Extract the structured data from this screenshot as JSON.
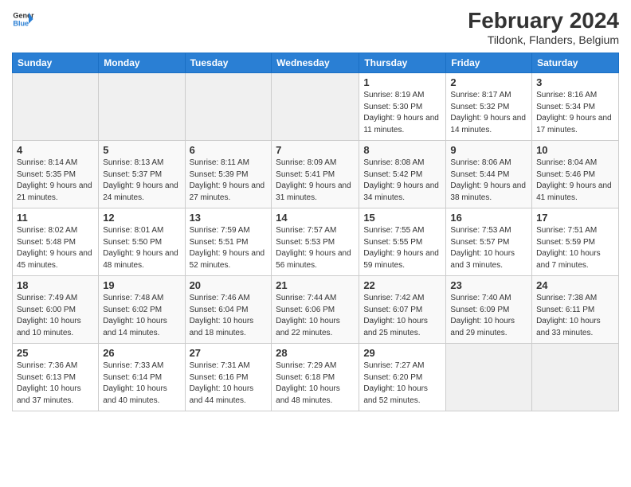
{
  "header": {
    "logo_line1": "General",
    "logo_line2": "Blue",
    "month_year": "February 2024",
    "location": "Tildonk, Flanders, Belgium"
  },
  "days_of_week": [
    "Sunday",
    "Monday",
    "Tuesday",
    "Wednesday",
    "Thursday",
    "Friday",
    "Saturday"
  ],
  "weeks": [
    [
      {
        "day": "",
        "info": ""
      },
      {
        "day": "",
        "info": ""
      },
      {
        "day": "",
        "info": ""
      },
      {
        "day": "",
        "info": ""
      },
      {
        "day": "1",
        "info": "Sunrise: 8:19 AM\nSunset: 5:30 PM\nDaylight: 9 hours and 11 minutes."
      },
      {
        "day": "2",
        "info": "Sunrise: 8:17 AM\nSunset: 5:32 PM\nDaylight: 9 hours and 14 minutes."
      },
      {
        "day": "3",
        "info": "Sunrise: 8:16 AM\nSunset: 5:34 PM\nDaylight: 9 hours and 17 minutes."
      }
    ],
    [
      {
        "day": "4",
        "info": "Sunrise: 8:14 AM\nSunset: 5:35 PM\nDaylight: 9 hours and 21 minutes."
      },
      {
        "day": "5",
        "info": "Sunrise: 8:13 AM\nSunset: 5:37 PM\nDaylight: 9 hours and 24 minutes."
      },
      {
        "day": "6",
        "info": "Sunrise: 8:11 AM\nSunset: 5:39 PM\nDaylight: 9 hours and 27 minutes."
      },
      {
        "day": "7",
        "info": "Sunrise: 8:09 AM\nSunset: 5:41 PM\nDaylight: 9 hours and 31 minutes."
      },
      {
        "day": "8",
        "info": "Sunrise: 8:08 AM\nSunset: 5:42 PM\nDaylight: 9 hours and 34 minutes."
      },
      {
        "day": "9",
        "info": "Sunrise: 8:06 AM\nSunset: 5:44 PM\nDaylight: 9 hours and 38 minutes."
      },
      {
        "day": "10",
        "info": "Sunrise: 8:04 AM\nSunset: 5:46 PM\nDaylight: 9 hours and 41 minutes."
      }
    ],
    [
      {
        "day": "11",
        "info": "Sunrise: 8:02 AM\nSunset: 5:48 PM\nDaylight: 9 hours and 45 minutes."
      },
      {
        "day": "12",
        "info": "Sunrise: 8:01 AM\nSunset: 5:50 PM\nDaylight: 9 hours and 48 minutes."
      },
      {
        "day": "13",
        "info": "Sunrise: 7:59 AM\nSunset: 5:51 PM\nDaylight: 9 hours and 52 minutes."
      },
      {
        "day": "14",
        "info": "Sunrise: 7:57 AM\nSunset: 5:53 PM\nDaylight: 9 hours and 56 minutes."
      },
      {
        "day": "15",
        "info": "Sunrise: 7:55 AM\nSunset: 5:55 PM\nDaylight: 9 hours and 59 minutes."
      },
      {
        "day": "16",
        "info": "Sunrise: 7:53 AM\nSunset: 5:57 PM\nDaylight: 10 hours and 3 minutes."
      },
      {
        "day": "17",
        "info": "Sunrise: 7:51 AM\nSunset: 5:59 PM\nDaylight: 10 hours and 7 minutes."
      }
    ],
    [
      {
        "day": "18",
        "info": "Sunrise: 7:49 AM\nSunset: 6:00 PM\nDaylight: 10 hours and 10 minutes."
      },
      {
        "day": "19",
        "info": "Sunrise: 7:48 AM\nSunset: 6:02 PM\nDaylight: 10 hours and 14 minutes."
      },
      {
        "day": "20",
        "info": "Sunrise: 7:46 AM\nSunset: 6:04 PM\nDaylight: 10 hours and 18 minutes."
      },
      {
        "day": "21",
        "info": "Sunrise: 7:44 AM\nSunset: 6:06 PM\nDaylight: 10 hours and 22 minutes."
      },
      {
        "day": "22",
        "info": "Sunrise: 7:42 AM\nSunset: 6:07 PM\nDaylight: 10 hours and 25 minutes."
      },
      {
        "day": "23",
        "info": "Sunrise: 7:40 AM\nSunset: 6:09 PM\nDaylight: 10 hours and 29 minutes."
      },
      {
        "day": "24",
        "info": "Sunrise: 7:38 AM\nSunset: 6:11 PM\nDaylight: 10 hours and 33 minutes."
      }
    ],
    [
      {
        "day": "25",
        "info": "Sunrise: 7:36 AM\nSunset: 6:13 PM\nDaylight: 10 hours and 37 minutes."
      },
      {
        "day": "26",
        "info": "Sunrise: 7:33 AM\nSunset: 6:14 PM\nDaylight: 10 hours and 40 minutes."
      },
      {
        "day": "27",
        "info": "Sunrise: 7:31 AM\nSunset: 6:16 PM\nDaylight: 10 hours and 44 minutes."
      },
      {
        "day": "28",
        "info": "Sunrise: 7:29 AM\nSunset: 6:18 PM\nDaylight: 10 hours and 48 minutes."
      },
      {
        "day": "29",
        "info": "Sunrise: 7:27 AM\nSunset: 6:20 PM\nDaylight: 10 hours and 52 minutes."
      },
      {
        "day": "",
        "info": ""
      },
      {
        "day": "",
        "info": ""
      }
    ]
  ]
}
